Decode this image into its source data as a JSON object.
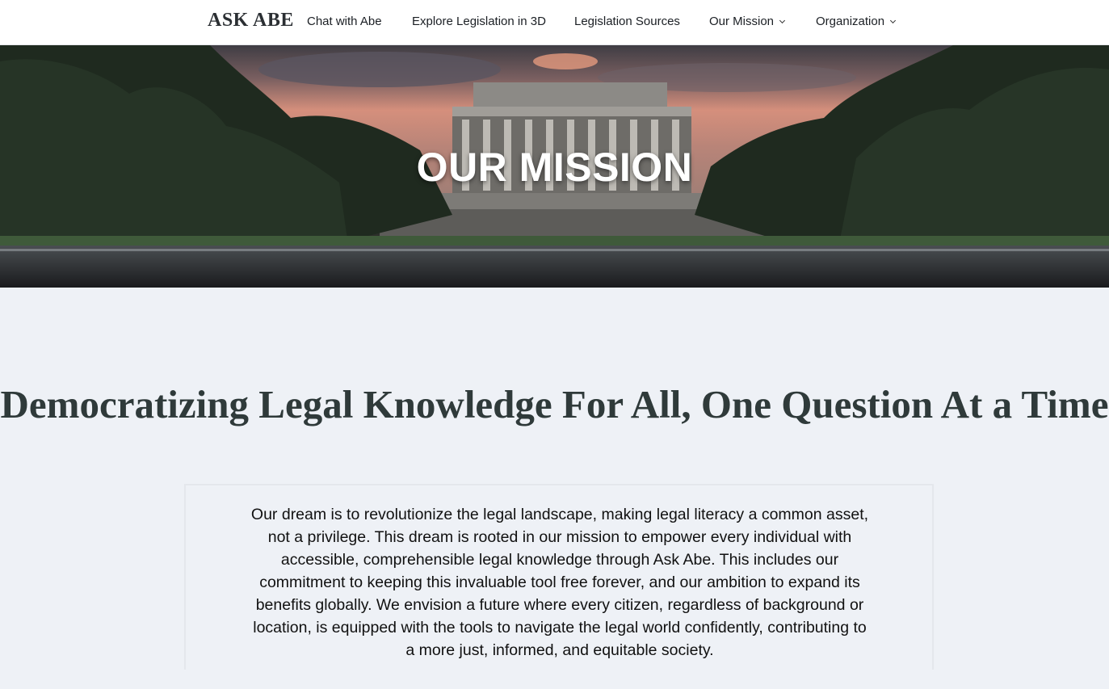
{
  "nav": {
    "logo": "ASK ABE",
    "items": [
      {
        "label": "Chat with Abe",
        "dropdown": false
      },
      {
        "label": "Explore Legislation in 3D",
        "dropdown": false
      },
      {
        "label": "Legislation Sources",
        "dropdown": false
      },
      {
        "label": "Our Mission",
        "dropdown": true
      },
      {
        "label": "Organization",
        "dropdown": true
      }
    ]
  },
  "hero": {
    "title": "OUR MISSION",
    "image": "lincoln-memorial-sunset-photo"
  },
  "main": {
    "headline": "Democratizing Legal Knowledge For All, One Question At a Time",
    "mission_text": "Our dream is to revolutionize the legal landscape, making legal literacy a common asset, not a privilege. This dream is rooted in our mission to empower every individual with accessible, comprehensible legal knowledge through Ask Abe. This includes our commitment to keeping this invaluable tool free forever, and our ambition to expand its benefits globally. We envision a future where every citizen, regardless of background or location, is equipped with the tools to navigate the legal world confidently, contributing to a more just, informed, and equitable society."
  },
  "colors": {
    "nav_bg": "#ffffff",
    "page_bg": "#eef1f6",
    "headline": "#2f3a3a",
    "hero_title": "#ffffff"
  }
}
